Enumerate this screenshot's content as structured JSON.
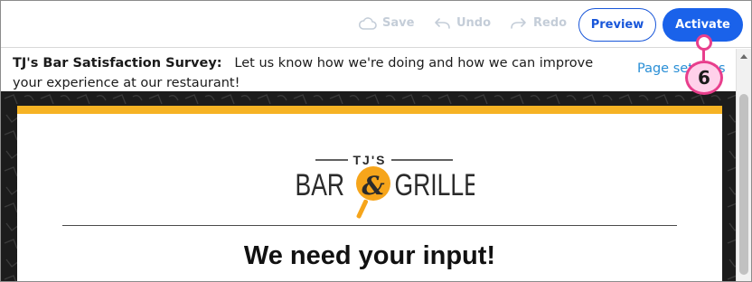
{
  "toolbar": {
    "save_label": "Save",
    "undo_label": "Undo",
    "redo_label": "Redo",
    "preview_label": "Preview",
    "activate_label": "Activate"
  },
  "survey": {
    "name": "TJ's Bar Satisfaction Survey:",
    "description": "Let us know how we're doing and how we can improve your experience at our restaurant!",
    "page_settings_label": "Page settings"
  },
  "callout": {
    "number": "6"
  },
  "logo": {
    "top_text": "TJ'S",
    "left_text": "BAR",
    "ampersand": "&",
    "right_text": "GRILLE"
  },
  "content": {
    "headline": "We need your input!"
  },
  "colors": {
    "accent_blue": "#1a62ea",
    "link_blue": "#2a8fd6",
    "banner_gold": "#f6b324",
    "callout_pink": "#e83e8c",
    "disabled_gray": "#c4cdd8"
  }
}
